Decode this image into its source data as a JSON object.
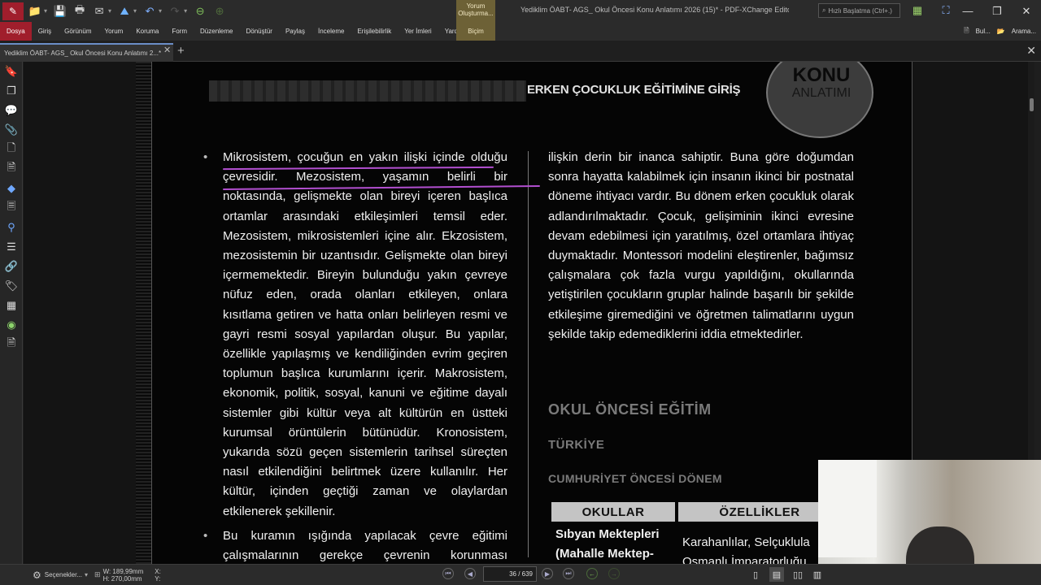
{
  "window": {
    "title": "Yediklim ÖABT- AGS_ Okul Öncesi Konu Anlatımı 2026 (15)* - PDF-XChange Editor",
    "quick_search": "Hızlı Başlatma (Ctrl+.)",
    "minimize": "—",
    "restore": "❐",
    "close": "✕",
    "context_tab_group": "Yorum Oluşturma..."
  },
  "ribbon": {
    "tabs": [
      "Dosya",
      "Giriş",
      "Görünüm",
      "Yorum",
      "Koruma",
      "Form",
      "Düzenleme",
      "Dönüştür",
      "Paylaş",
      "İnceleme",
      "Erişilebilirlik",
      "Yer İmleri",
      "Yardım"
    ],
    "context_tab": "Biçim",
    "right_items": [
      "Bul...",
      "Arama..."
    ]
  },
  "document_tab": {
    "label": "Yediklim ÖABT- AGS_ Okul Öncesi Konu Anlatımı 2...*",
    "close": "✕",
    "new": "+"
  },
  "page": {
    "header_title": "ERKEN ÇOCUKLUK EĞİTİMİNE GİRİŞ",
    "badge_line1": "KONU",
    "badge_line2": "ANLATIMI",
    "left_paragraphs": [
      "Mikrosistem, çocuğun en yakın ilişki içinde olduğu çevresidir. Mezosistem, yaşamın belirli bir noktasında, gelişmekte olan bireyi içeren başlıca ortamlar arasındaki etkileşimleri temsil eder. Mezosistem, mikrosistemleri içine alır. Ekzosistem, mezosistemin bir uzantısıdır. Gelişmekte olan bireyi içermemektedir. Bireyin bulunduğu yakın çevreye nüfuz eden, orada olanları etkileyen, onlara kısıtlama getiren ve hatta onları belirleyen resmi ve gayri resmi sosyal yapılardan oluşur. Bu yapılar, özellikle yapılaşmış ve kendiliğinden evrim geçiren toplumun başlıca kurumlarını içerir. Makrosistem, ekonomik, politik, sosyal, kanuni ve eğitime dayalı sistemler gibi kültür veya alt kültürün en üstteki kurumsal örüntülerin bütünüdür. Kronosistem, yukarıda sözü geçen sistemlerin tarihsel süreçten nasıl etkilendiğini belirtmek üzere kullanılır. Her kültür, içinden geçtiği zaman ve olaylardan etkilenerek şekillenir.",
      "Bu kuramın ışığında yapılacak çevre eğitimi çalışmalarının gerekçe çevrenin korunması açısından"
    ],
    "right_paragraph": "ilişkin derin bir inanca sahiptir. Buna göre doğumdan sonra hayatta kalabilmek için insanın ikinci bir postnatal döneme ihtiyacı vardır. Bu dönem erken çocukluk olarak adlandırılmaktadır. Çocuk, gelişiminin ikinci evresine devam edebilmesi için yaratılmış, özel ortamlara ihtiyaç duymaktadır. Montessori modelini eleştirenler, bağımsız çalışmalara çok fazla vurgu yapıldığını, okullarında yetiştirilen çocukların gruplar halinde başarılı bir şekilde etkileşime giremediğini ve öğretmen talimatlarını uygun şekilde takip edemediklerini iddia etmektedirler.",
    "section_heading": "OKUL ÖNCESİ EĞİTİM",
    "sub_heading": "TÜRKİYE",
    "sub_sub_heading": "CUMHURİYET ÖNCESİ DÖNEM",
    "table": {
      "headers": [
        "OKULLAR",
        "ÖZELLİKLER"
      ],
      "row1_col1": "Sıbyan Mektepleri (Mahalle Mektep-",
      "row1_col2": "Karahanlılar, Selçuklula Osmanlı İmparatorluğu"
    }
  },
  "statusbar": {
    "options": "Seçenekler...",
    "width": "W: 189,99mm",
    "height": "H: 270,00mm",
    "x": "X:",
    "y": "Y:",
    "page_indicator": "36 / 639"
  },
  "colors": {
    "file_tab": "#a01e2c",
    "context_tab": "#6d6136",
    "annotation": "#b24fd0"
  }
}
